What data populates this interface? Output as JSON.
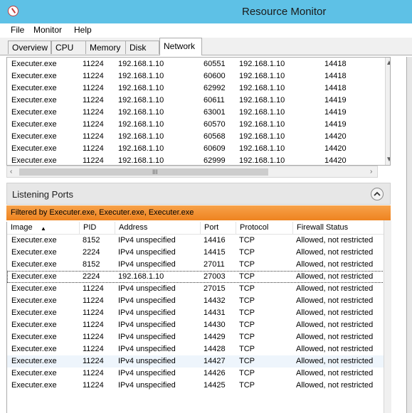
{
  "window": {
    "title": "Resource Monitor",
    "app_icon": "resource-monitor-icon"
  },
  "menu": [
    "File",
    "Monitor",
    "Help"
  ],
  "tabs": [
    {
      "label": "Overview",
      "active": false
    },
    {
      "label": "CPU",
      "active": false
    },
    {
      "label": "Memory",
      "active": false
    },
    {
      "label": "Disk",
      "active": false
    },
    {
      "label": "Network",
      "active": true
    }
  ],
  "tcp_connections": {
    "rows": [
      [
        "Executer.exe",
        "11224",
        "192.168.1.10",
        "60551",
        "192.168.1.10",
        "14418"
      ],
      [
        "Executer.exe",
        "11224",
        "192.168.1.10",
        "60600",
        "192.168.1.10",
        "14418"
      ],
      [
        "Executer.exe",
        "11224",
        "192.168.1.10",
        "62992",
        "192.168.1.10",
        "14418"
      ],
      [
        "Executer.exe",
        "11224",
        "192.168.1.10",
        "60611",
        "192.168.1.10",
        "14419"
      ],
      [
        "Executer.exe",
        "11224",
        "192.168.1.10",
        "63001",
        "192.168.1.10",
        "14419"
      ],
      [
        "Executer.exe",
        "11224",
        "192.168.1.10",
        "60570",
        "192.168.1.10",
        "14419"
      ],
      [
        "Executer.exe",
        "11224",
        "192.168.1.10",
        "60568",
        "192.168.1.10",
        "14420"
      ],
      [
        "Executer.exe",
        "11224",
        "192.168.1.10",
        "60609",
        "192.168.1.10",
        "14420"
      ],
      [
        "Executer.exe",
        "11224",
        "192.168.1.10",
        "62999",
        "192.168.1.10",
        "14420"
      ]
    ],
    "hscroll_grip": "III"
  },
  "listening_ports": {
    "title": "Listening Ports",
    "filter_text": "Filtered by Executer.exe, Executer.exe, Executer.exe",
    "columns": [
      "Image",
      "PID",
      "Address",
      "Port",
      "Protocol",
      "Firewall Status"
    ],
    "sort_column": "Image",
    "sort_direction": "ascending",
    "rows": [
      [
        "Executer.exe",
        "8152",
        "IPv4 unspecified",
        "14416",
        "TCP",
        "Allowed, not restricted"
      ],
      [
        "Executer.exe",
        "2224",
        "IPv4 unspecified",
        "14415",
        "TCP",
        "Allowed, not restricted"
      ],
      [
        "Executer.exe",
        "8152",
        "IPv4 unspecified",
        "27011",
        "TCP",
        "Allowed, not restricted"
      ],
      [
        "Executer.exe",
        "2224",
        "192.168.1.10",
        "27003",
        "TCP",
        "Allowed, not restricted"
      ],
      [
        "Executer.exe",
        "11224",
        "IPv4 unspecified",
        "27015",
        "TCP",
        "Allowed, not restricted"
      ],
      [
        "Executer.exe",
        "11224",
        "IPv4 unspecified",
        "14432",
        "TCP",
        "Allowed, not restricted"
      ],
      [
        "Executer.exe",
        "11224",
        "IPv4 unspecified",
        "14431",
        "TCP",
        "Allowed, not restricted"
      ],
      [
        "Executer.exe",
        "11224",
        "IPv4 unspecified",
        "14430",
        "TCP",
        "Allowed, not restricted"
      ],
      [
        "Executer.exe",
        "11224",
        "IPv4 unspecified",
        "14429",
        "TCP",
        "Allowed, not restricted"
      ],
      [
        "Executer.exe",
        "11224",
        "IPv4 unspecified",
        "14428",
        "TCP",
        "Allowed, not restricted"
      ],
      [
        "Executer.exe",
        "11224",
        "IPv4 unspecified",
        "14427",
        "TCP",
        "Allowed, not restricted"
      ],
      [
        "Executer.exe",
        "11224",
        "IPv4 unspecified",
        "14426",
        "TCP",
        "Allowed, not restricted"
      ],
      [
        "Executer.exe",
        "11224",
        "IPv4 unspecified",
        "14425",
        "TCP",
        "Allowed, not restricted"
      ]
    ],
    "selected_row": 3,
    "highlighted_row": 10
  },
  "colors": {
    "titlebar": "#5ec1e6",
    "filter_bar": "#ee8320"
  }
}
